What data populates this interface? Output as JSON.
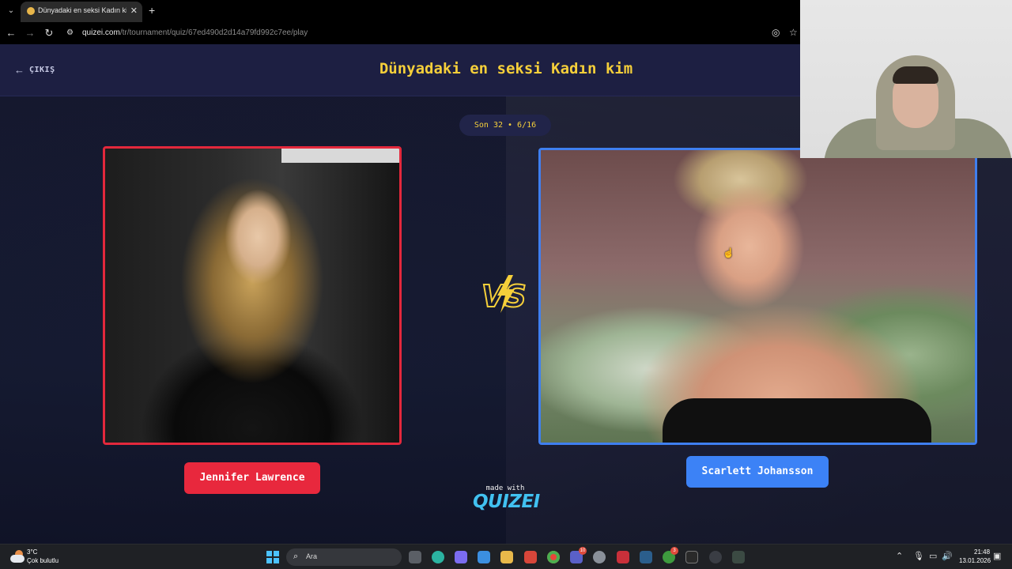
{
  "browser": {
    "tab_title": "Dünyadaki en seksi Kadın kim -",
    "url_host": "quizei.com",
    "url_path": "/tr/tournament/quiz/67ed490d2d14a79fd992c7ee/play"
  },
  "header": {
    "exit_label": "ÇIKIŞ",
    "title": "Dünyadaki en seksi Kadın kim"
  },
  "round": {
    "label": "Son 32 • 6/16"
  },
  "left": {
    "name": "Jennifer Lawrence",
    "accent": "#e8283d"
  },
  "right": {
    "name": "Scarlett Johansson",
    "accent": "#3c82f6"
  },
  "footer": {
    "made_with": "made with",
    "logo": "QUIZEI"
  },
  "taskbar": {
    "temperature": "3°C",
    "weather": "Çok bulutlu",
    "search_label": "Ara",
    "time": "21:48",
    "date": "13.01.2026",
    "badges": {
      "teams": "10",
      "xbox": "3"
    }
  }
}
